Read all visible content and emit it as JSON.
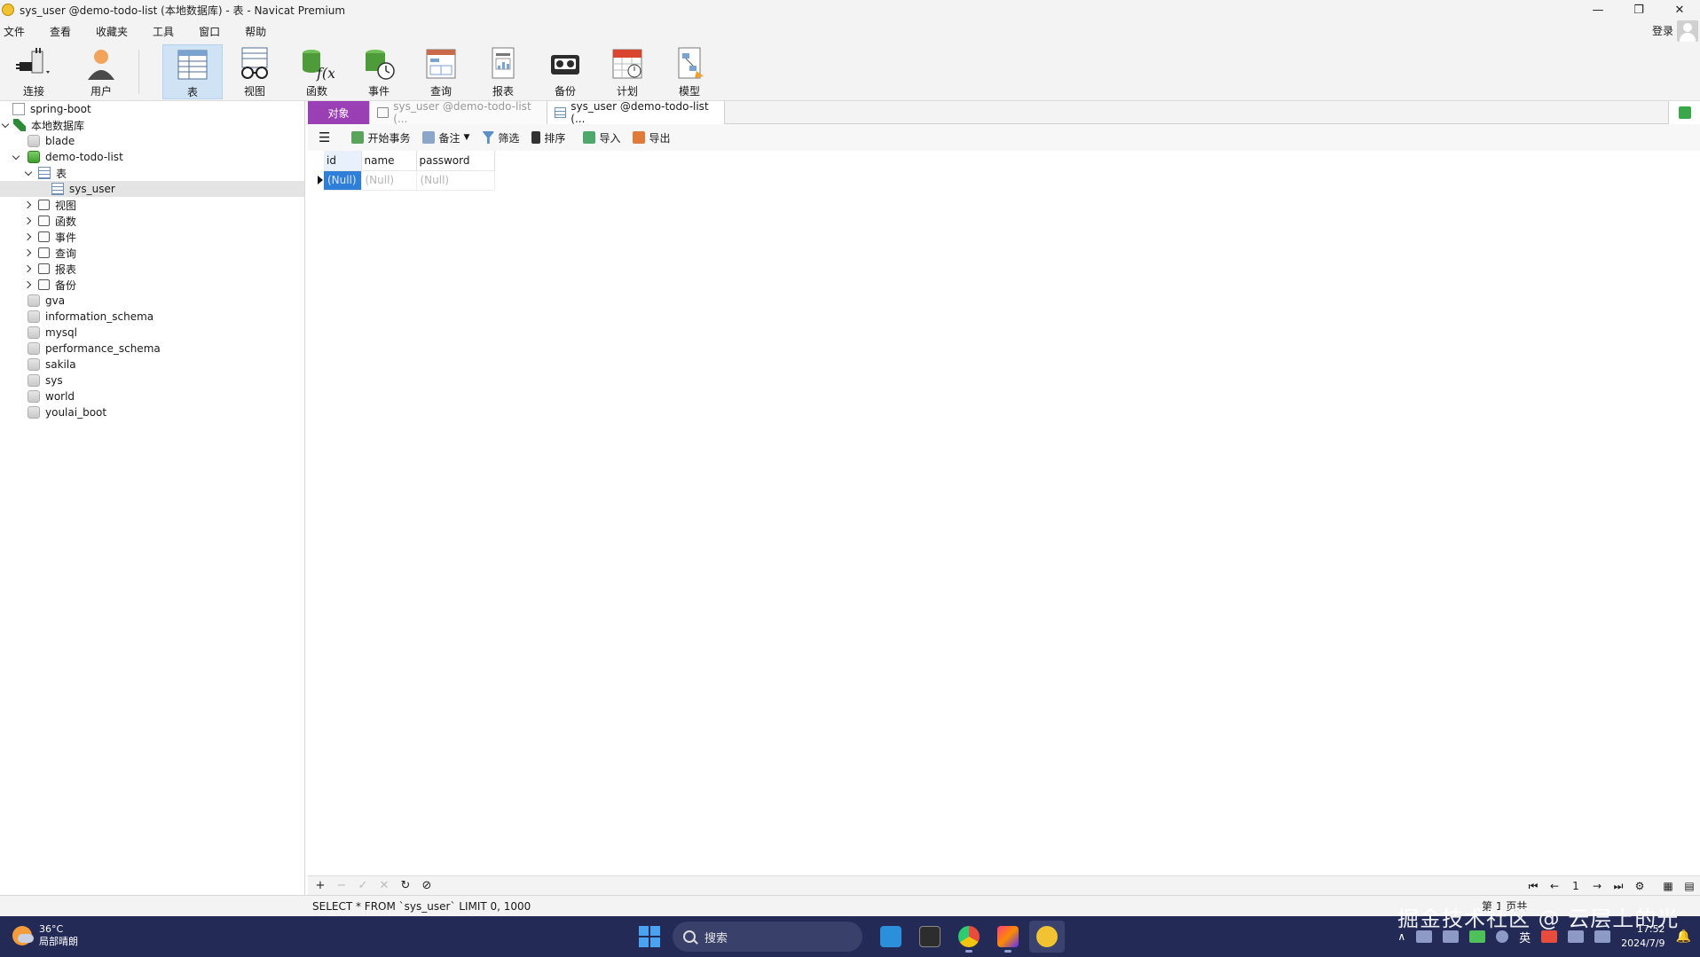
{
  "window": {
    "title": "sys_user @demo-todo-list (本地数据库) - 表 - Navicat Premium",
    "controls": [
      "—",
      "❐",
      "✕"
    ]
  },
  "menu": {
    "items": [
      "文件",
      "查看",
      "收藏夹",
      "工具",
      "窗口",
      "帮助"
    ],
    "login_label": "登录"
  },
  "toolbar": {
    "buttons": [
      {
        "label": "连接",
        "icon": "plug-icon"
      },
      {
        "label": "用户",
        "icon": "user-icon"
      },
      {
        "label": "表",
        "icon": "table-icon",
        "active": true
      },
      {
        "label": "视图",
        "icon": "view-glasses-icon"
      },
      {
        "label": "函数",
        "icon": "function-icon"
      },
      {
        "label": "事件",
        "icon": "event-clock-icon"
      },
      {
        "label": "查询",
        "icon": "query-icon"
      },
      {
        "label": "报表",
        "icon": "report-icon"
      },
      {
        "label": "备份",
        "icon": "backup-icon"
      },
      {
        "label": "计划",
        "icon": "calendar-icon"
      },
      {
        "label": "模型",
        "icon": "model-icon"
      }
    ]
  },
  "tree": {
    "items": [
      {
        "label": "spring-boot",
        "level": 0,
        "caret": "",
        "icon": "conn-grey"
      },
      {
        "label": "本地数据库",
        "level": 0,
        "caret": "open",
        "icon": "conn-green"
      },
      {
        "label": "blade",
        "level": 1,
        "caret": "",
        "icon": "db-grey"
      },
      {
        "label": "demo-todo-list",
        "level": 1,
        "caret": "open",
        "icon": "db-green"
      },
      {
        "label": "表",
        "level": 2,
        "caret": "open",
        "icon": "table-ic"
      },
      {
        "label": "sys_user",
        "level": 3,
        "caret": "",
        "icon": "table-ic",
        "selected": true
      },
      {
        "label": "视图",
        "level": 2,
        "caret": "closed",
        "icon": "small-ic"
      },
      {
        "label": "函数",
        "level": 2,
        "caret": "closed",
        "icon": "small-ic"
      },
      {
        "label": "事件",
        "level": 2,
        "caret": "closed",
        "icon": "small-ic"
      },
      {
        "label": "查询",
        "level": 2,
        "caret": "closed",
        "icon": "small-ic"
      },
      {
        "label": "报表",
        "level": 2,
        "caret": "closed",
        "icon": "small-ic"
      },
      {
        "label": "备份",
        "level": 2,
        "caret": "closed",
        "icon": "small-ic"
      },
      {
        "label": "gva",
        "level": 1,
        "caret": "",
        "icon": "db-grey"
      },
      {
        "label": "information_schema",
        "level": 1,
        "caret": "",
        "icon": "db-grey"
      },
      {
        "label": "mysql",
        "level": 1,
        "caret": "",
        "icon": "db-grey"
      },
      {
        "label": "performance_schema",
        "level": 1,
        "caret": "",
        "icon": "db-grey"
      },
      {
        "label": "sakila",
        "level": 1,
        "caret": "",
        "icon": "db-grey"
      },
      {
        "label": "sys",
        "level": 1,
        "caret": "",
        "icon": "db-grey"
      },
      {
        "label": "world",
        "level": 1,
        "caret": "",
        "icon": "db-grey"
      },
      {
        "label": "youlai_boot",
        "level": 1,
        "caret": "",
        "icon": "db-grey"
      }
    ]
  },
  "tabs": {
    "object_label": "对象",
    "tab1_label": "sys_user @demo-todo-list (...",
    "tab2_label": "sys_user @demo-todo-list (..."
  },
  "subtoolbar": {
    "begin_tx": "开始事务",
    "memo": "备注",
    "filter": "筛选",
    "sort": "排序",
    "import": "导入",
    "export": "导出"
  },
  "grid": {
    "columns": [
      "id",
      "name",
      "password"
    ],
    "rows": [
      [
        "(Null)",
        "(Null)",
        "(Null)"
      ]
    ]
  },
  "bottom": {
    "add": "+",
    "remove": "−",
    "apply": "✓",
    "discard": "✕",
    "refresh": "↻",
    "stop": "⊘",
    "page_first": "⏮",
    "page_prev": "←",
    "page_num": "1",
    "page_next": "→",
    "page_last": "⏭",
    "settings": "⚙"
  },
  "status": {
    "sql": "SELECT * FROM `sys_user` LIMIT 0, 1000",
    "page_info": "第 1 页共"
  },
  "taskbar": {
    "temperature": "36°C",
    "weather": "局部晴朗",
    "search_placeholder": "搜索",
    "ime": "英",
    "time": "17:52",
    "date": "2024/7/9",
    "watermark": "掘金技术社区 @ 云层上的光"
  },
  "colors": {
    "object_tab": "#9b3fb4",
    "selected_cell": "#2f7fd8",
    "taskbar": "#232a56"
  }
}
